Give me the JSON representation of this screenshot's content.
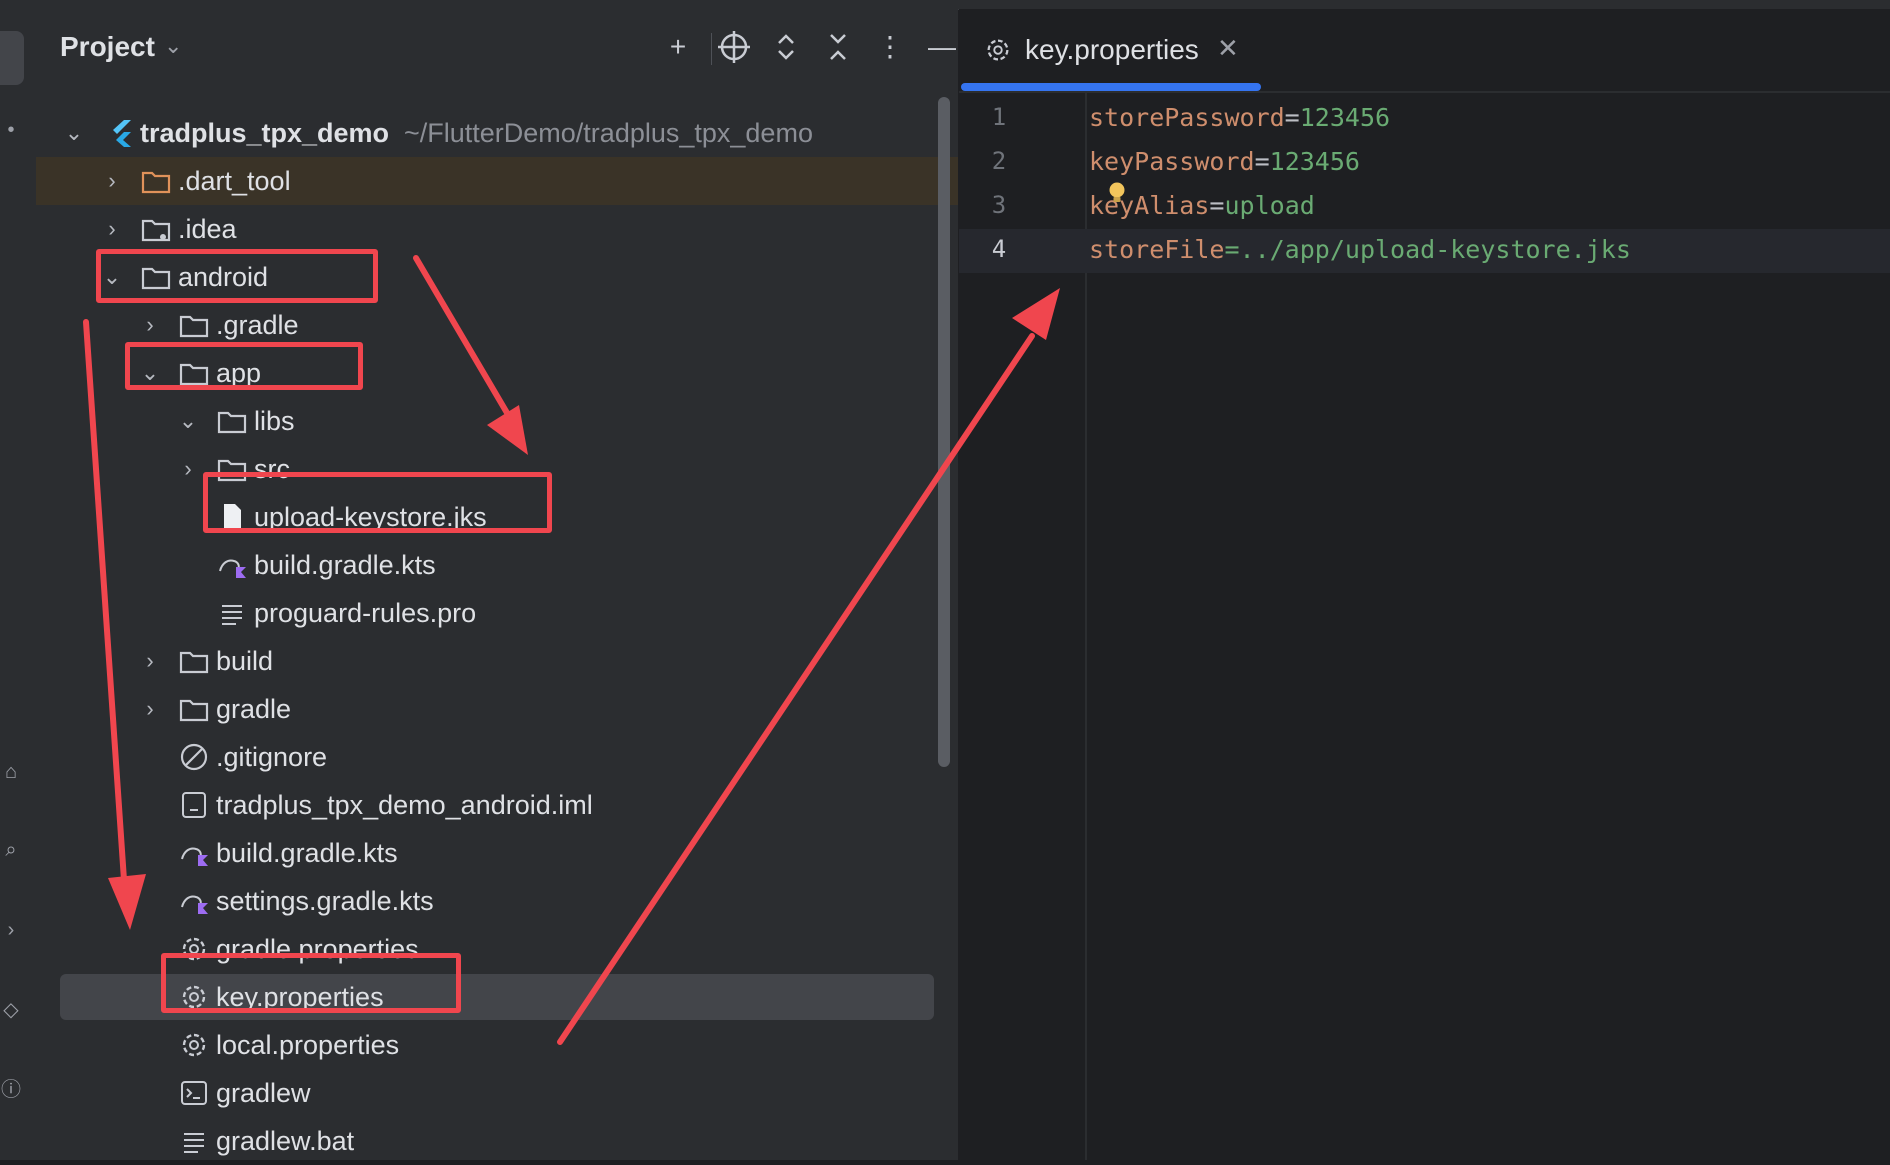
{
  "project_panel": {
    "title": "Project",
    "root": {
      "name": "tradplus_tpx_demo",
      "path": "~/FlutterDemo/tradplus_tpx_demo"
    },
    "items": [
      {
        "name": ".dart_tool"
      },
      {
        "name": ".idea"
      },
      {
        "name": "android"
      },
      {
        "name": ".gradle"
      },
      {
        "name": "app"
      },
      {
        "name": "libs"
      },
      {
        "name": "src"
      },
      {
        "name": "upload-keystore.jks"
      },
      {
        "name": "build.gradle.kts"
      },
      {
        "name": "proguard-rules.pro"
      },
      {
        "name": "build"
      },
      {
        "name": "gradle"
      },
      {
        "name": ".gitignore"
      },
      {
        "name": "tradplus_tpx_demo_android.iml"
      },
      {
        "name": "build.gradle.kts"
      },
      {
        "name": "settings.gradle.kts"
      },
      {
        "name": "gradle.properties"
      },
      {
        "name": "key.properties"
      },
      {
        "name": "local.properties"
      },
      {
        "name": "gradlew"
      },
      {
        "name": "gradlew.bat"
      }
    ]
  },
  "editor": {
    "tab": {
      "label": "key.properties",
      "icon": "gear-icon",
      "close_icon": "close-icon"
    },
    "lines": [
      {
        "num": "1",
        "key": "storePassword",
        "eq": "=",
        "value": "123456"
      },
      {
        "num": "2",
        "key": "keyPassword",
        "eq": "=",
        "value": "123456"
      },
      {
        "num": "3",
        "key": "keyAlias",
        "eq": "=",
        "value": "upload"
      },
      {
        "num": "4",
        "key": "storeFile",
        "eq": "=",
        "value": "../app/upload-keystore.jks"
      }
    ]
  },
  "colors": {
    "accent": "#3574f0",
    "annotation_red": "#f0464e",
    "code_key": "#cf8e6d",
    "code_value": "#6aab73"
  }
}
